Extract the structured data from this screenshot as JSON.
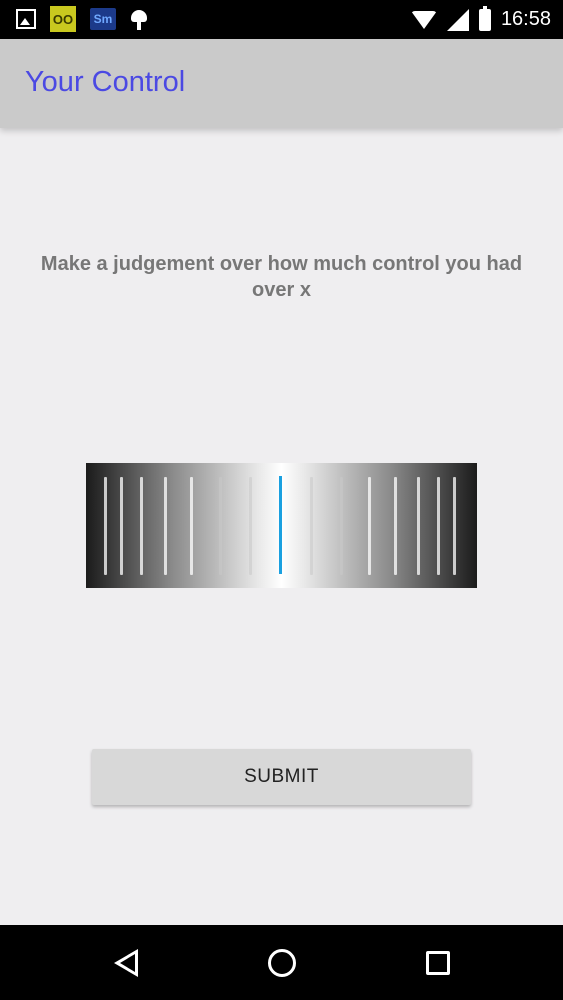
{
  "status_bar": {
    "time": "16:58",
    "left_icons": [
      "image-icon",
      "oo-app-icon",
      "sm-app-icon",
      "android-icon"
    ],
    "oo_label": "OO",
    "sm_label": "Sm",
    "right_icons": [
      "wifi-icon",
      "signal-icon",
      "battery-icon"
    ]
  },
  "app_bar": {
    "title": "Your Control"
  },
  "main": {
    "prompt": "Make a judgement over how much control you had over x",
    "slider": {
      "type": "wheel",
      "indicator_color": "#1aa0e0"
    },
    "submit_label": "SUBMIT"
  },
  "nav_bar": {
    "icons": [
      "back-icon",
      "home-icon",
      "recents-icon"
    ]
  },
  "colors": {
    "accent": "#4b49e3",
    "background": "#efeef0",
    "app_bar": "#cacaca"
  }
}
